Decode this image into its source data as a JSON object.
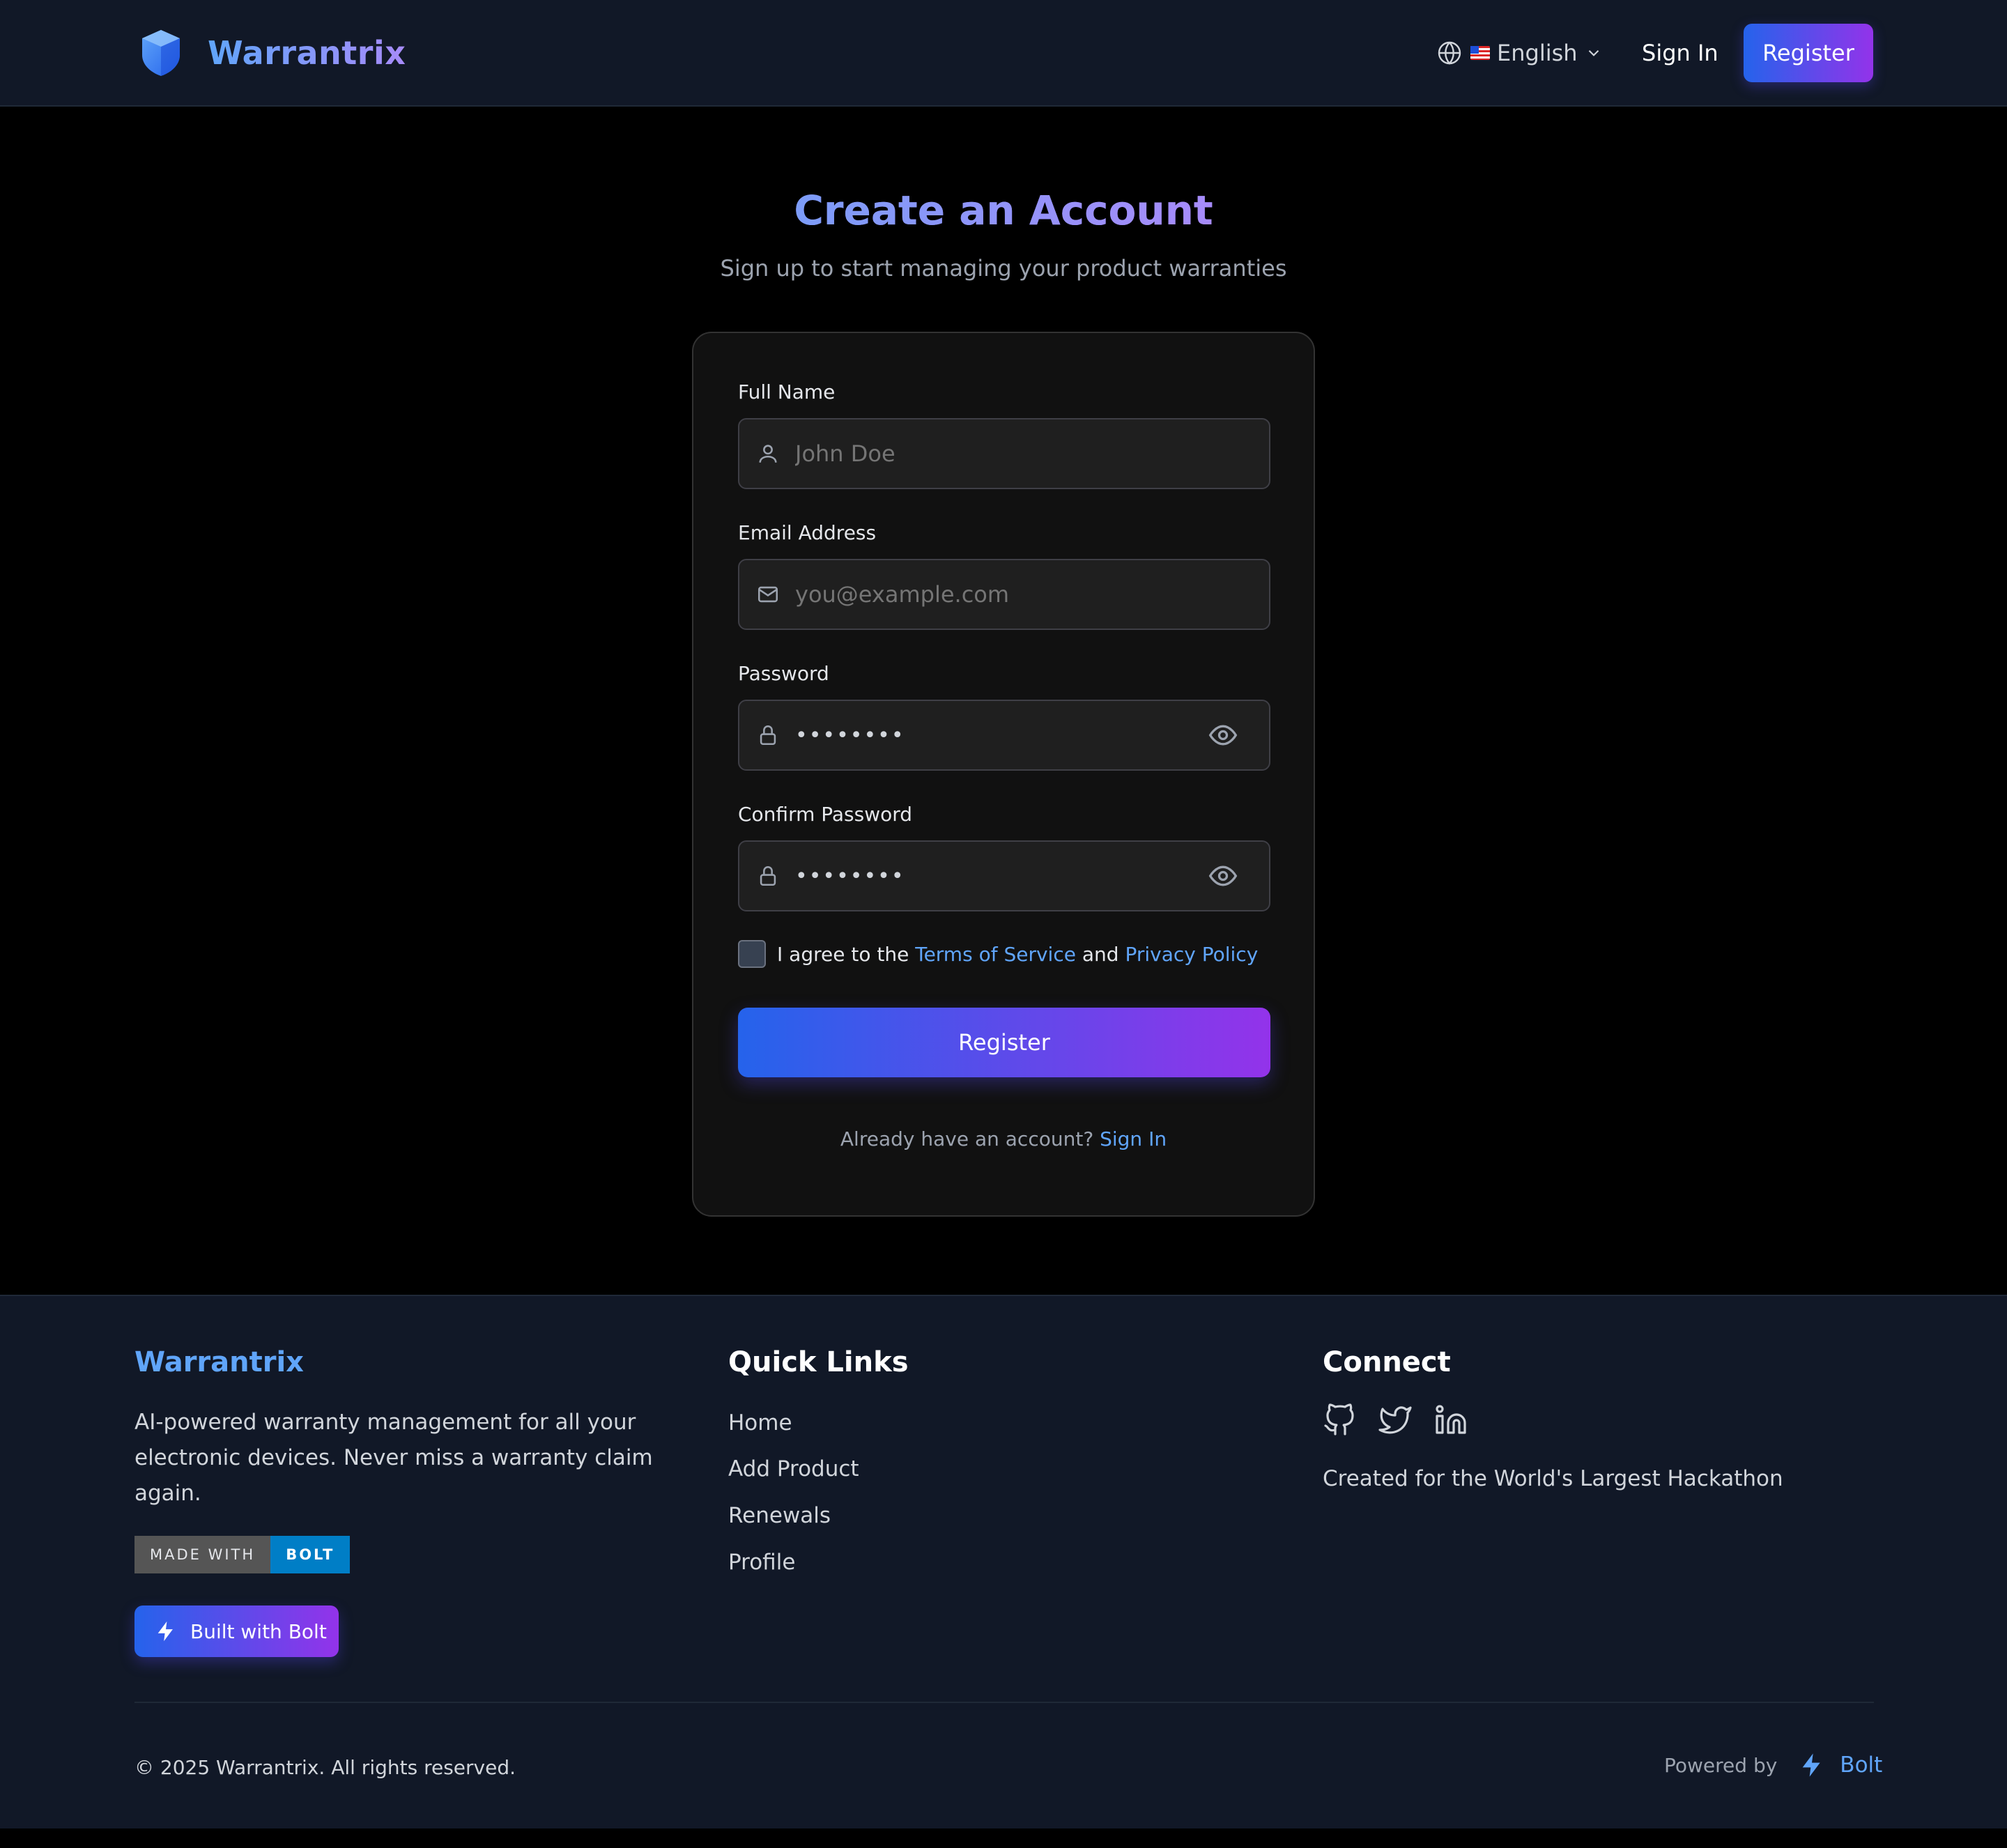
{
  "header": {
    "brand": "Warrantrix",
    "language": "English",
    "sign_in": "Sign In",
    "register": "Register"
  },
  "main": {
    "title": "Create an Account",
    "subtitle": "Sign up to start managing your product warranties"
  },
  "form": {
    "full_name_label": "Full Name",
    "full_name_placeholder": "John Doe",
    "email_label": "Email Address",
    "email_placeholder": "you@example.com",
    "password_label": "Password",
    "password_value": "••••••••",
    "confirm_label": "Confirm Password",
    "confirm_value": "••••••••",
    "agree_prefix": "I agree to the",
    "terms": "Terms of Service",
    "and": "and",
    "privacy": "Privacy Policy",
    "submit": "Register",
    "already_text": "Already have an account?",
    "sign_in_link": "Sign In"
  },
  "footer": {
    "brand": "Warrantrix",
    "description": "AI-powered warranty management for all your electronic devices. Never miss a warranty claim again.",
    "badge_left": "MADE WITH",
    "badge_right": "BOLT",
    "built_with": "Built with Bolt",
    "quick_links_title": "Quick Links",
    "quick_links": [
      "Home",
      "Add Product",
      "Renewals",
      "Profile"
    ],
    "connect_title": "Connect",
    "created_for": "Created for the World's Largest Hackathon",
    "copyright": "© 2025 Warrantrix. All rights reserved.",
    "powered_by": "Powered by",
    "powered_name": "Bolt"
  },
  "icons": {
    "logo": "shield-logo-icon",
    "globe": "globe-icon",
    "flag": "us-flag-icon",
    "chevron": "chevron-down-icon",
    "user": "user-icon",
    "mail": "mail-icon",
    "lock": "lock-icon",
    "eye": "eye-icon",
    "zap": "zap-icon",
    "github": "github-icon",
    "twitter": "twitter-icon",
    "linkedin": "linkedin-icon"
  },
  "colors": {
    "background": "#000000",
    "header_bg": "#111827",
    "card_bg": "#111111",
    "accent_blue": "#2563eb",
    "accent_purple": "#9333ea",
    "link": "#60a5fa"
  }
}
